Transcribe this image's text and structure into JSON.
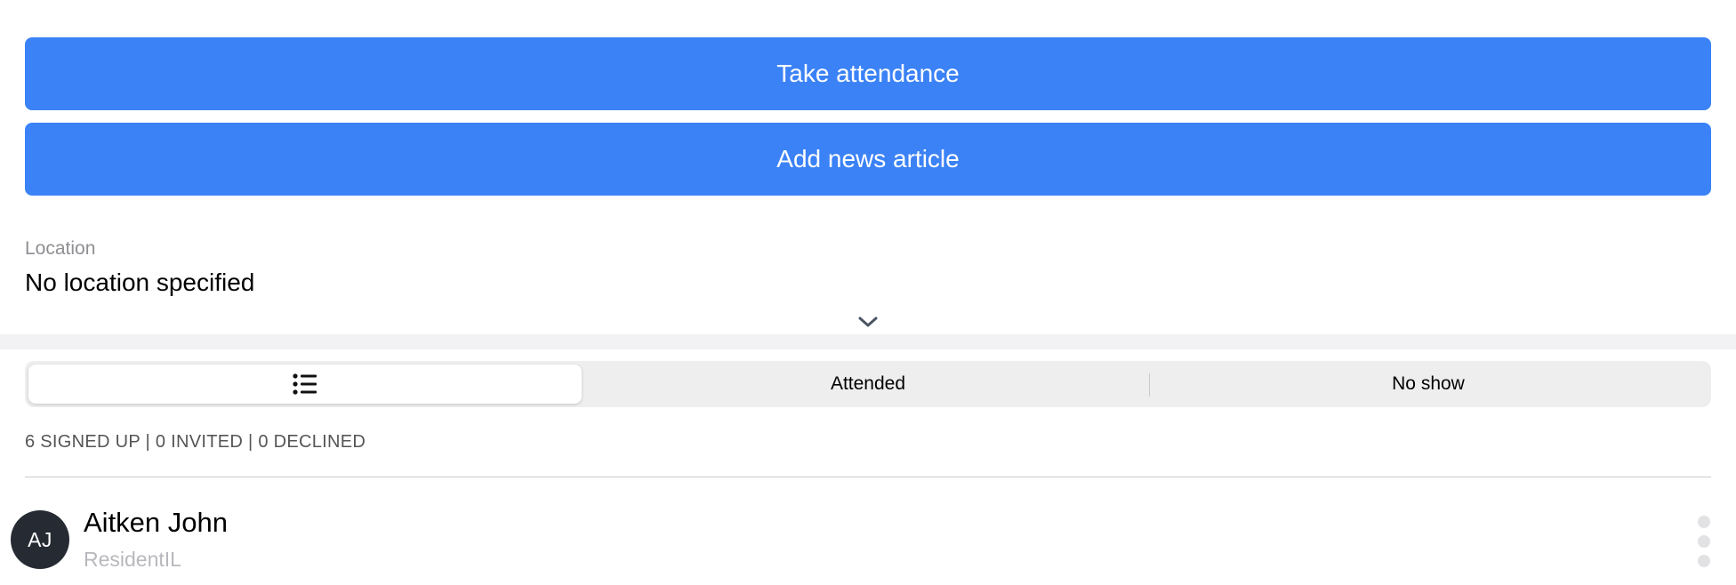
{
  "actions": {
    "take_attendance_label": "Take attendance",
    "add_news_label": "Add news article"
  },
  "location": {
    "label": "Location",
    "value": "No location specified",
    "expand_icon": "chevron-down-icon"
  },
  "filter": {
    "all_icon": "list-icon",
    "attended_label": "Attended",
    "no_show_label": "No show",
    "selected": "all"
  },
  "summary": {
    "counts": "6 SIGNED UP | 0 INVITED | 0 DECLINED"
  },
  "attendees": [
    {
      "initials": "AJ",
      "name": "Aitken John",
      "role": "ResidentIL"
    }
  ],
  "colors": {
    "primary": "#3b82f6",
    "avatar": "#262b33",
    "muted_text": "#8e8e93",
    "segment_bg": "#eeeeef",
    "band": "#f2f2f4"
  }
}
